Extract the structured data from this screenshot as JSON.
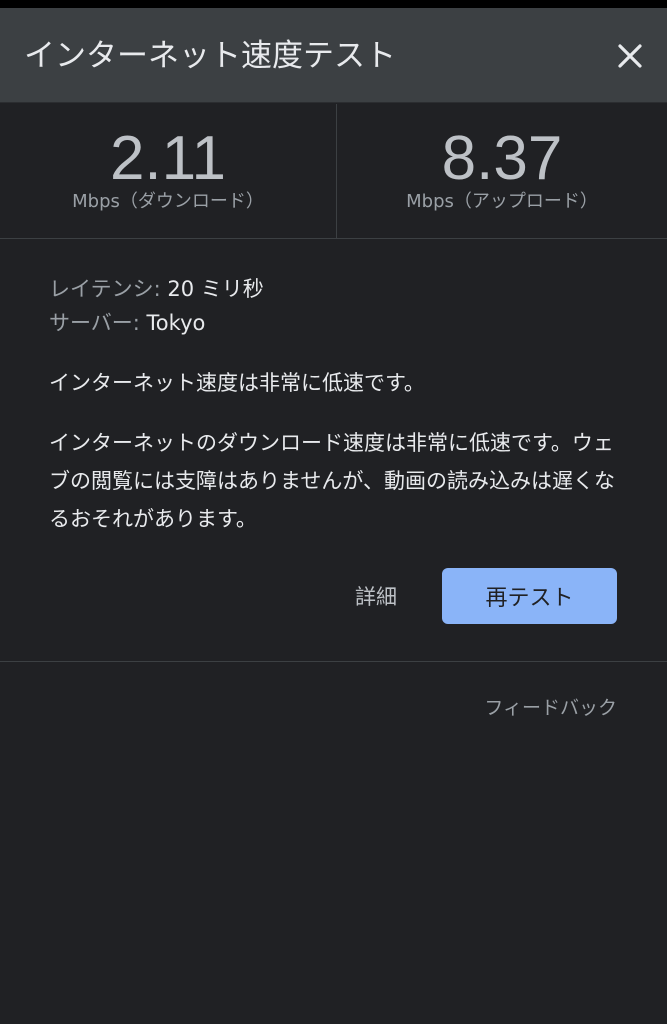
{
  "header": {
    "title": "インターネット速度テスト",
    "close_icon": "close-icon"
  },
  "results": {
    "download": {
      "value": "2.11",
      "unit": "Mbps（ダウンロード）"
    },
    "upload": {
      "value": "8.37",
      "unit": "Mbps（アップロード）"
    }
  },
  "details": {
    "latency_label": "レイテンシ: ",
    "latency_value": "20 ミリ秒",
    "server_label": "サーバー: ",
    "server_value": "Tokyo"
  },
  "summary": "インターネット速度は非常に低速です。",
  "description": "インターネットのダウンロード速度は非常に低速です。ウェブの閲覧には支障はありませんが、動画の読み込みは遅くなるおそれがあります。",
  "actions": {
    "details_label": "詳細",
    "retest_label": "再テスト"
  },
  "footer": {
    "feedback_label": "フィードバック"
  },
  "colors": {
    "background": "#202124",
    "header": "#3c4043",
    "accent": "#8ab4f8"
  }
}
